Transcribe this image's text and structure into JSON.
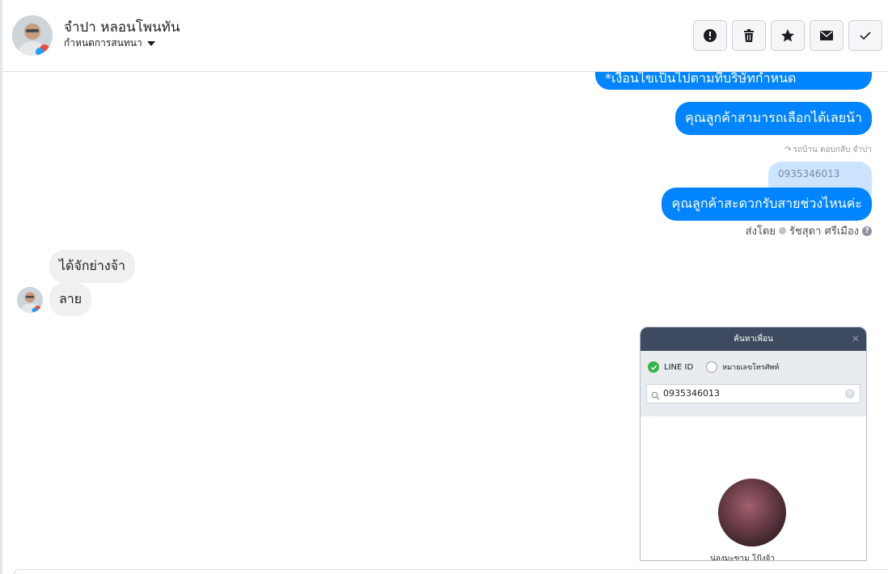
{
  "header": {
    "contact_name": "จำปา หลอนโพนทัน",
    "assign_label": "กำหนดการสนทนา",
    "actions": [
      {
        "name": "spam-button",
        "icon": "alert-circle-icon"
      },
      {
        "name": "delete-button",
        "icon": "trash-icon"
      },
      {
        "name": "star-button",
        "icon": "star-icon"
      },
      {
        "name": "mark-unread-button",
        "icon": "envelope-icon"
      },
      {
        "name": "mark-done-button",
        "icon": "check-icon"
      }
    ]
  },
  "messages": {
    "out_partial": "*เงื่อนไขเป็นไปตามที่บริษัทกำหนด",
    "out_1": "คุณลูกค้าสามารถเลือกได้เลยน้า",
    "reply_note": "รถบ้าน ตอบกลับ จำปา",
    "quoted_text": "0935346013",
    "out_2": "คุณลูกค้าสะดวกรับสายช่วงไหนค่ะ",
    "sent_by_prefix": "ส่งโดย",
    "sent_by_name": "รัชสุดา ศรีเมือง",
    "in_1": "ได้จักย่างจ้า",
    "in_2": "ลาย"
  },
  "attachment": {
    "title": "ค้นหาเพื่อน",
    "option_line_id": "LINE ID",
    "option_phone": "หมายเลขโทรศัพท์",
    "search_value": "0935346013",
    "result_name": "น่องมะขาม โป้งจ้า"
  },
  "colors": {
    "outgoing_bubble": "#0084ff",
    "incoming_bubble": "#f0f0f0",
    "line_green": "#38b14a"
  }
}
